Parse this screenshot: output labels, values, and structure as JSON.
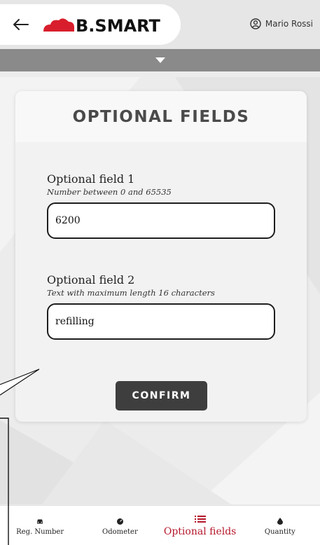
{
  "header": {
    "logo_text": "B.SMART",
    "user_name": "Mario Rossi"
  },
  "icons": {
    "back": "arrow-left-icon",
    "user": "user-circle-icon",
    "collapse": "triangle-down-icon",
    "reg_number": "car-icon",
    "odometer": "gauge-icon",
    "optional_fields": "list-icon",
    "quantity": "drop-icon"
  },
  "colors": {
    "brand_red": "#d81e2c",
    "active_nav": "#b5172a"
  },
  "card": {
    "title": "OPTIONAL FIELDS",
    "fields": [
      {
        "label": "Optional field 1",
        "hint": "Number between 0 and 65535",
        "value": "6200"
      },
      {
        "label": "Optional field 2",
        "hint": "Text with maximum length 16 characters",
        "value": "refilling"
      }
    ],
    "confirm_label": "CONFIRM"
  },
  "nav": {
    "items": [
      {
        "label": "Reg. Number"
      },
      {
        "label": "Odometer"
      },
      {
        "label": "Optional fields",
        "active": true
      },
      {
        "label": "Quantity"
      }
    ]
  }
}
